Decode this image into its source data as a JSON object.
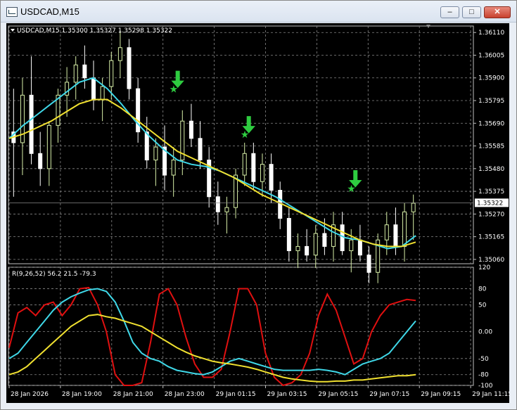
{
  "window": {
    "title": "USDCAD,M15",
    "minimize_glyph": "‒",
    "maximize_glyph": "□",
    "close_glyph": "✕"
  },
  "chart_info": {
    "symbol_line": "USDCAD,M15  1.35300 1.35327 1.35298 1.35322",
    "current_price": "1.35322",
    "indicator_line": "R(9,26,52) 56.2 21.5 -79.3"
  },
  "colors": {
    "background": "#000000",
    "bull_candle": "#d8f0a8",
    "bear_candle": "#ffffff",
    "ma_fast": "#3fd8e8",
    "ma_slow": "#f0e030",
    "signal": "#2ecc40",
    "osc_red": "#e01010",
    "osc_cyan": "#3fd8e8",
    "osc_yellow": "#f0e030",
    "grid": "#888888"
  },
  "chart_data": [
    {
      "type": "candlestick",
      "title": "USDCAD,M15",
      "price_ticks": [
        "1.36110",
        "1.36005",
        "1.35900",
        "1.35795",
        "1.35690",
        "1.35585",
        "1.35480",
        "1.35375",
        "1.35270",
        "1.35165",
        "1.35060"
      ],
      "time_ticks": [
        "28 Jan 2026",
        "28 Jan 19:00",
        "28 Jan 21:00",
        "28 Jan 23:00",
        "29 Jan 01:15",
        "29 Jan 03:15",
        "29 Jan 05:15",
        "29 Jan 07:15",
        "29 Jan 09:15",
        "29 Jan 11:15"
      ],
      "ylim": [
        1.3504,
        1.3614
      ],
      "candles": [
        [
          1.3565,
          1.3585,
          1.3535,
          1.356
        ],
        [
          1.356,
          1.359,
          1.3545,
          1.3582
        ],
        [
          1.3582,
          1.36,
          1.355,
          1.3555
        ],
        [
          1.3555,
          1.3565,
          1.354,
          1.3548
        ],
        [
          1.3548,
          1.357,
          1.354,
          1.3568
        ],
        [
          1.3568,
          1.3585,
          1.356,
          1.3582
        ],
        [
          1.3582,
          1.3595,
          1.3572,
          1.3588
        ],
        [
          1.3588,
          1.36,
          1.358,
          1.3596
        ],
        [
          1.3596,
          1.3605,
          1.3585,
          1.359
        ],
        [
          1.359,
          1.3598,
          1.3575,
          1.358
        ],
        [
          1.358,
          1.359,
          1.357,
          1.3586
        ],
        [
          1.3586,
          1.3602,
          1.358,
          1.3598
        ],
        [
          1.3598,
          1.3612,
          1.359,
          1.3604
        ],
        [
          1.3604,
          1.3608,
          1.358,
          1.3585
        ],
        [
          1.3585,
          1.359,
          1.356,
          1.3565
        ],
        [
          1.3565,
          1.3572,
          1.3548,
          1.3552
        ],
        [
          1.3552,
          1.3562,
          1.354,
          1.3558
        ],
        [
          1.3558,
          1.3568,
          1.3538,
          1.3545
        ],
        [
          1.3545,
          1.3558,
          1.3535,
          1.3552
        ],
        [
          1.3552,
          1.3575,
          1.3545,
          1.357
        ],
        [
          1.357,
          1.3578,
          1.3558,
          1.3562
        ],
        [
          1.3562,
          1.357,
          1.3548,
          1.3552
        ],
        [
          1.3552,
          1.3558,
          1.353,
          1.3535
        ],
        [
          1.3535,
          1.3542,
          1.3522,
          1.3528
        ],
        [
          1.3528,
          1.3535,
          1.3518,
          1.353
        ],
        [
          1.353,
          1.3548,
          1.3525,
          1.3545
        ],
        [
          1.3545,
          1.356,
          1.354,
          1.3555
        ],
        [
          1.3555,
          1.356,
          1.3538,
          1.3542
        ],
        [
          1.3542,
          1.3555,
          1.3535,
          1.355
        ],
        [
          1.355,
          1.3555,
          1.3532,
          1.3538
        ],
        [
          1.3538,
          1.3542,
          1.352,
          1.3525
        ],
        [
          1.3525,
          1.353,
          1.3505,
          1.351
        ],
        [
          1.351,
          1.3518,
          1.3502,
          1.3512
        ],
        [
          1.3512,
          1.352,
          1.3505,
          1.3508
        ],
        [
          1.3508,
          1.3522,
          1.3502,
          1.3518
        ],
        [
          1.3518,
          1.3525,
          1.3508,
          1.3512
        ],
        [
          1.3512,
          1.3528,
          1.3505,
          1.3522
        ],
        [
          1.3522,
          1.3528,
          1.3508,
          1.351
        ],
        [
          1.351,
          1.352,
          1.35,
          1.3515
        ],
        [
          1.3515,
          1.3522,
          1.3505,
          1.3508
        ],
        [
          1.3508,
          1.3512,
          1.3495,
          1.35
        ],
        [
          1.35,
          1.3518,
          1.3495,
          1.3515
        ],
        [
          1.3515,
          1.3528,
          1.3508,
          1.3522
        ],
        [
          1.3522,
          1.353,
          1.3508,
          1.3512
        ],
        [
          1.3512,
          1.3532,
          1.3505,
          1.3528
        ],
        [
          1.3528,
          1.3536,
          1.3515,
          1.3532
        ]
      ],
      "ma_fast": [
        1.3562,
        1.3568,
        1.3573,
        1.3578,
        1.3583,
        1.3588,
        1.359,
        1.3585,
        1.3578,
        1.357,
        1.3563,
        1.3557,
        1.3552,
        1.355,
        1.3549,
        1.3547,
        1.3544,
        1.3541,
        1.3538,
        1.3535,
        1.3531,
        1.3527,
        1.3523,
        1.3519,
        1.3516,
        1.3515,
        1.3513,
        1.3511,
        1.3512,
        1.3517
      ],
      "ma_slow": [
        1.3562,
        1.3564,
        1.3567,
        1.357,
        1.3574,
        1.3578,
        1.358,
        1.358,
        1.3576,
        1.3571,
        1.3566,
        1.3561,
        1.3556,
        1.3553,
        1.355,
        1.3547,
        1.3544,
        1.354,
        1.3536,
        1.3533,
        1.353,
        1.3527,
        1.3524,
        1.3521,
        1.3518,
        1.3515,
        1.3513,
        1.3512,
        1.3512,
        1.3514
      ],
      "signals": [
        {
          "index": 18,
          "price": 1.3578
        },
        {
          "index": 26,
          "price": 1.3557
        },
        {
          "index": 38,
          "price": 1.3532
        }
      ]
    },
    {
      "type": "line",
      "title": "R(9,26,52)",
      "value_ticks": [
        "120",
        "80",
        "50",
        "0.00",
        "-50",
        "-80",
        "-100"
      ],
      "ylim": [
        -100,
        120
      ],
      "series": [
        {
          "values": [
            -30,
            35,
            45,
            30,
            50,
            55,
            30,
            50,
            80,
            82,
            50,
            0,
            -80,
            -100,
            -100,
            -95,
            -20,
            70,
            80,
            50,
            -10,
            -60,
            -85,
            -85,
            -70,
            0,
            80,
            80,
            50,
            -40,
            -85,
            -100,
            -95,
            -80,
            -40,
            30,
            70,
            40,
            -10,
            -60,
            -50,
            0,
            30,
            50,
            55,
            60,
            58
          ]
        },
        {
          "values": [
            -50,
            -40,
            -20,
            0,
            20,
            40,
            55,
            65,
            72,
            78,
            80,
            75,
            55,
            20,
            -20,
            -40,
            -50,
            -55,
            -65,
            -72,
            -75,
            -78,
            -80,
            -75,
            -65,
            -55,
            -50,
            -55,
            -60,
            -65,
            -70,
            -72,
            -72,
            -72,
            -72,
            -70,
            -72,
            -75,
            -80,
            -70,
            -60,
            -55,
            -50,
            -40,
            -20,
            0,
            20
          ]
        },
        {
          "values": [
            -80,
            -75,
            -65,
            -50,
            -35,
            -20,
            -5,
            10,
            20,
            30,
            32,
            28,
            25,
            20,
            15,
            10,
            0,
            -10,
            -20,
            -30,
            -38,
            -45,
            -50,
            -55,
            -58,
            -60,
            -63,
            -66,
            -70,
            -75,
            -80,
            -85,
            -88,
            -90,
            -92,
            -93,
            -93,
            -92,
            -92,
            -90,
            -90,
            -88,
            -86,
            -84,
            -82,
            -82,
            -80
          ]
        }
      ]
    }
  ]
}
